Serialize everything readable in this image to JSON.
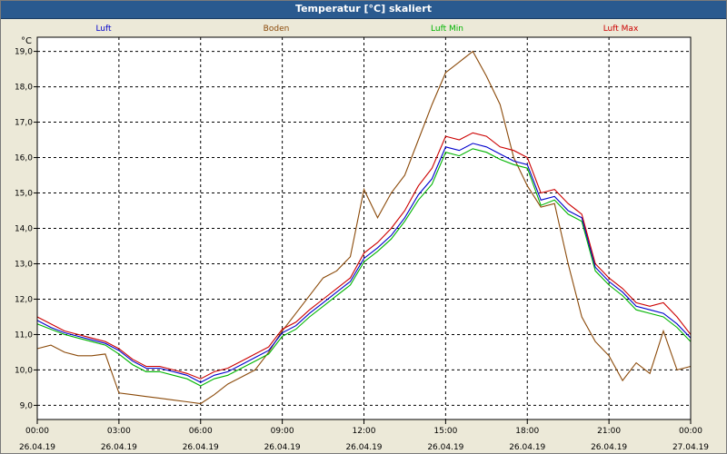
{
  "window": {
    "title": "Temperatur [°C] skaliert"
  },
  "chart_data": {
    "type": "line",
    "title": "Temperatur [°C] skaliert",
    "ylabel": "°C",
    "xlabel": "",
    "ylim": [
      8.6,
      19.4
    ],
    "xlim": [
      0,
      24
    ],
    "grid": true,
    "legend_placement": "top",
    "yticks": [
      {
        "value": 9.0,
        "label": "9,0"
      },
      {
        "value": 10.0,
        "label": "10,0"
      },
      {
        "value": 11.0,
        "label": "11,0"
      },
      {
        "value": 12.0,
        "label": "12,0"
      },
      {
        "value": 13.0,
        "label": "13,0"
      },
      {
        "value": 14.0,
        "label": "14,0"
      },
      {
        "value": 15.0,
        "label": "15,0"
      },
      {
        "value": 16.0,
        "label": "16,0"
      },
      {
        "value": 17.0,
        "label": "17,0"
      },
      {
        "value": 18.0,
        "label": "18,0"
      },
      {
        "value": 19.0,
        "label": "19,0"
      }
    ],
    "xticks": [
      {
        "value": 0,
        "time": "00:00",
        "date": "26.04.19"
      },
      {
        "value": 3,
        "time": "03:00",
        "date": "26.04.19"
      },
      {
        "value": 6,
        "time": "06:00",
        "date": "26.04.19"
      },
      {
        "value": 9,
        "time": "09:00",
        "date": "26.04.19"
      },
      {
        "value": 12,
        "time": "12:00",
        "date": "26.04.19"
      },
      {
        "value": 15,
        "time": "15:00",
        "date": "26.04.19"
      },
      {
        "value": 18,
        "time": "18:00",
        "date": "26.04.19"
      },
      {
        "value": 21,
        "time": "21:00",
        "date": "26.04.19"
      },
      {
        "value": 24,
        "time": "00:00",
        "date": "27.04.19"
      }
    ],
    "x": [
      0,
      0.5,
      1,
      1.5,
      2,
      2.5,
      3,
      3.5,
      4,
      4.5,
      5,
      5.5,
      6,
      6.5,
      7,
      7.5,
      8,
      8.5,
      9,
      9.5,
      10,
      10.5,
      11,
      11.5,
      12,
      12.5,
      13,
      13.5,
      14,
      14.5,
      15,
      15.5,
      16,
      16.5,
      17,
      17.5,
      18,
      18.5,
      19,
      19.5,
      20,
      20.5,
      21,
      21.5,
      22,
      22.5,
      23,
      23.5,
      24
    ],
    "series": [
      {
        "name": "Luft",
        "color": "#0000cc",
        "values": [
          11.4,
          11.2,
          11.05,
          10.95,
          10.85,
          10.75,
          10.55,
          10.25,
          10.05,
          10.05,
          9.95,
          9.85,
          9.65,
          9.85,
          9.95,
          10.15,
          10.35,
          10.55,
          11.05,
          11.25,
          11.6,
          11.9,
          12.2,
          12.5,
          13.15,
          13.45,
          13.8,
          14.3,
          14.95,
          15.4,
          16.3,
          16.2,
          16.4,
          16.3,
          16.1,
          15.9,
          15.8,
          14.8,
          14.9,
          14.5,
          14.3,
          12.9,
          12.5,
          12.2,
          11.8,
          11.7,
          11.6,
          11.3,
          10.9
        ]
      },
      {
        "name": "Boden",
        "color": "#8b4a0a",
        "values": [
          10.6,
          10.7,
          10.5,
          10.4,
          10.4,
          10.45,
          9.35,
          9.3,
          9.25,
          9.2,
          9.15,
          9.1,
          9.05,
          9.3,
          9.6,
          9.8,
          10.0,
          10.5,
          11.1,
          11.6,
          12.1,
          12.6,
          12.8,
          13.2,
          15.1,
          14.3,
          15.0,
          15.5,
          16.5,
          17.5,
          18.4,
          18.7,
          19.0,
          18.3,
          17.5,
          16.0,
          15.2,
          14.6,
          14.7,
          13.0,
          11.5,
          10.8,
          10.4,
          9.7,
          10.2,
          9.9,
          11.1,
          10.0,
          10.1
        ]
      },
      {
        "name": "Luft Min",
        "color": "#00b400",
        "values": [
          11.3,
          11.15,
          11.0,
          10.9,
          10.8,
          10.7,
          10.45,
          10.15,
          9.95,
          9.95,
          9.85,
          9.75,
          9.55,
          9.75,
          9.85,
          10.05,
          10.25,
          10.45,
          10.95,
          11.15,
          11.5,
          11.8,
          12.1,
          12.4,
          13.05,
          13.35,
          13.7,
          14.2,
          14.8,
          15.25,
          16.15,
          16.05,
          16.25,
          16.15,
          15.95,
          15.8,
          15.7,
          14.65,
          14.8,
          14.4,
          14.2,
          12.8,
          12.4,
          12.1,
          11.7,
          11.6,
          11.5,
          11.2,
          10.8
        ]
      },
      {
        "name": "Luft Max",
        "color": "#cc0000",
        "values": [
          11.5,
          11.3,
          11.1,
          11.0,
          10.9,
          10.8,
          10.6,
          10.3,
          10.1,
          10.1,
          10.0,
          9.9,
          9.75,
          9.95,
          10.05,
          10.25,
          10.45,
          10.65,
          11.15,
          11.35,
          11.7,
          12.0,
          12.3,
          12.6,
          13.3,
          13.6,
          14.0,
          14.5,
          15.2,
          15.7,
          16.6,
          16.5,
          16.7,
          16.6,
          16.3,
          16.2,
          16.0,
          15.0,
          15.1,
          14.7,
          14.4,
          13.0,
          12.6,
          12.3,
          11.9,
          11.8,
          11.9,
          11.5,
          11.0
        ]
      }
    ]
  }
}
